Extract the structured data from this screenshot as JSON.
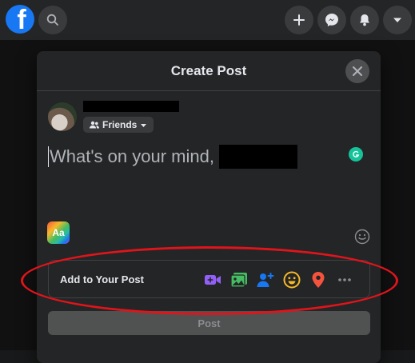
{
  "header": {
    "logo_letter": "f",
    "icons": [
      "search-icon",
      "plus-icon",
      "messenger-icon",
      "bell-icon",
      "caret-down-icon"
    ]
  },
  "modal": {
    "title": "Create Post",
    "audience_label": "Friends",
    "placeholder": "What's on your mind,",
    "aa_label": "Aa",
    "add_to_post_label": "Add to Your Post",
    "add_icons": [
      "live-video-icon",
      "photo-icon",
      "tag-people-icon",
      "feeling-icon",
      "check-in-icon",
      "more-icon"
    ],
    "post_button_label": "Post"
  },
  "colors": {
    "brand": "#1877f2",
    "live_video": "#9360f7",
    "photo": "#45bd62",
    "tag_people": "#1877f2",
    "feeling": "#f7b928",
    "check_in": "#f5533d",
    "annotation": "#e0141b"
  }
}
